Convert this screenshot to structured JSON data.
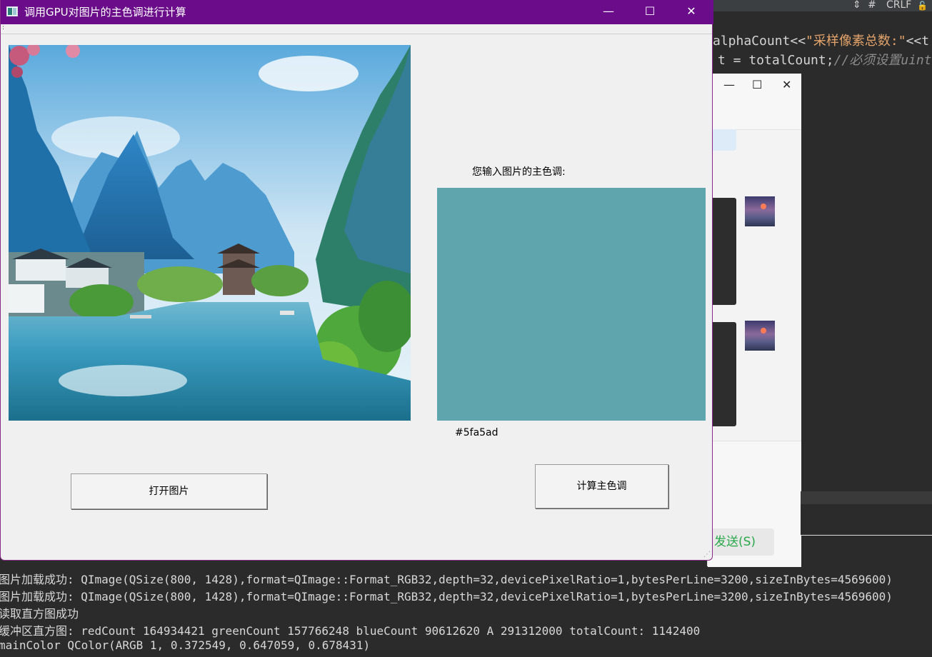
{
  "window": {
    "title": "调用GPU对图片的主色调进行计算",
    "minimize_glyph": "—",
    "maximize_glyph": "☐",
    "close_glyph": "✕",
    "menubar_glyph": ":"
  },
  "main": {
    "color_label": "您输入图片的主色调:",
    "color_hex": "#5fa5ad",
    "swatch_color": "#5fa5ad",
    "open_button": "打开图片",
    "calc_button": "计算主色调"
  },
  "editor": {
    "topbar_arrows": "⇕",
    "topbar_hash": "#",
    "topbar_crlf": "CRLF",
    "topbar_lock": "🔓",
    "code_line1_a": "alphaCount<<",
    "code_line1_str": "\"采样像素总数:\"",
    "code_line1_b": "<<t",
    "code_line2_a": "t = totalCount;",
    "code_line2_cmt": "//必须设置uint"
  },
  "chat": {
    "minimize_glyph": "—",
    "maximize_glyph": "☐",
    "close_glyph": "✕",
    "send_label": "发送(S)"
  },
  "console": [
    "图片加载成功: QImage(QSize(800, 1428),format=QImage::Format_RGB32,depth=32,devicePixelRatio=1,bytesPerLine=3200,sizeInBytes=4569600)",
    "图片加载成功: QImage(QSize(800, 1428),format=QImage::Format_RGB32,depth=32,devicePixelRatio=1,bytesPerLine=3200,sizeInBytes=4569600)",
    "读取直方图成功",
    "缓冲区直方图:  redCount 164934421 greenCount 157766248 blueCount 90612620 A 291312000 totalCount: 1142400",
    "mainColor QColor(ARGB 1, 0.372549, 0.647059, 0.678431)"
  ]
}
